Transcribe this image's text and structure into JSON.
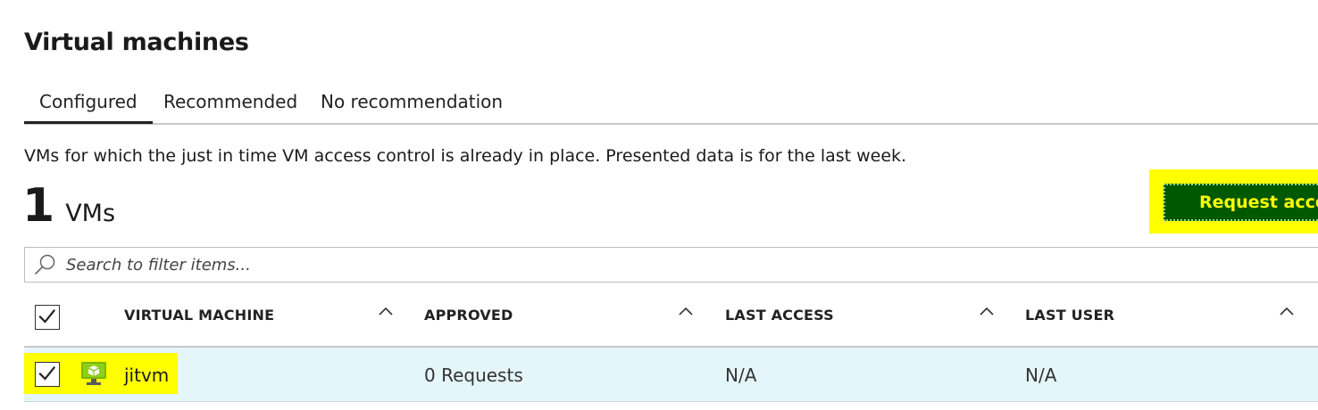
{
  "page": {
    "title": "Virtual machines"
  },
  "tabs": [
    {
      "label": "Configured",
      "active": true
    },
    {
      "label": "Recommended",
      "active": false
    },
    {
      "label": "No recommendation",
      "active": false
    }
  ],
  "description": "VMs for which the just in time VM access control is already in place. Presented data is for the last week.",
  "summary": {
    "count": "1",
    "unit": "VMs"
  },
  "actions": {
    "request_access_label": "Request access"
  },
  "search": {
    "placeholder": "Search to filter items..."
  },
  "table": {
    "select_all_checked": true,
    "columns": [
      {
        "label": "VIRTUAL MACHINE",
        "sort_icon": "chevron-up-icon"
      },
      {
        "label": "APPROVED",
        "sort_icon": "chevron-up-icon"
      },
      {
        "label": "LAST ACCESS",
        "sort_icon": "chevron-up-icon"
      },
      {
        "label": "LAST USER",
        "sort_icon": "chevron-up-icon"
      }
    ],
    "rows": [
      {
        "checked": true,
        "icon": "virtual-machine-icon",
        "virtual_machine": "jitvm",
        "approved": "0 Requests",
        "last_access": "N/A",
        "last_user": "N/A"
      }
    ]
  },
  "colors": {
    "highlight": "#ffff00",
    "button_background": "#005800",
    "button_text": "#ffff00",
    "selected_row": "#e5f6fb",
    "vm_icon_green": "#7ab800"
  }
}
